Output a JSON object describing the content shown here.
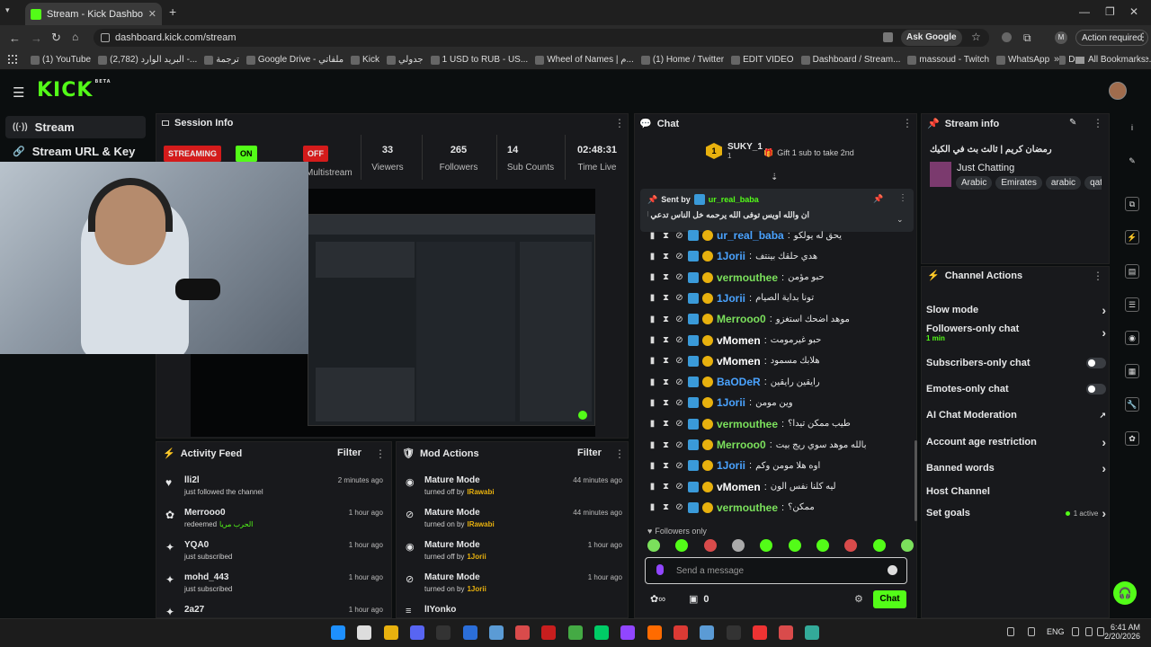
{
  "browser": {
    "tab_title": "Stream - Kick Dashboard",
    "url": "dashboard.kick.com/stream",
    "ask_google": "Ask Google",
    "action_required": "Action required",
    "profile_initial": "M"
  },
  "bookmarks": [
    "(1) YouTube",
    "(2,782) البريد الوارد -...",
    "ترجمة",
    "Google Drive - ملفاتي",
    "Kick",
    "جدولي",
    "1 USD to RUB - US...",
    "Wheel of Names | م...",
    "(1) Home / Twitter",
    "EDIT VIDEO",
    "Dashboard / Stream...",
    "massoud - Twitch",
    "WhatsApp",
    "Dashboard – Restre..."
  ],
  "all_bookmarks": "All Bookmarks",
  "logo": {
    "text": "KICK",
    "beta": "BETA"
  },
  "sidebar": {
    "items": [
      {
        "label": "Stream"
      },
      {
        "label": "Stream URL & Key"
      }
    ]
  },
  "session": {
    "title": "Session Info",
    "streaming": "STREAMING",
    "on": "ON",
    "off": "OFF",
    "multistream": "Multistream",
    "stats": [
      {
        "value": "33",
        "label": "Viewers"
      },
      {
        "value": "265",
        "label": "Followers"
      },
      {
        "value": "14",
        "label": "Sub Counts"
      },
      {
        "value": "02:48:31",
        "label": "Time Live"
      }
    ]
  },
  "activity": {
    "title": "Activity Feed",
    "filter": "Filter",
    "rows": [
      {
        "user": "lli2l",
        "text": "just followed the channel",
        "time": "2 minutes ago"
      },
      {
        "user": "Merrooo0",
        "text": "redeemed",
        "extra": "الحرب مريا",
        "time": "1 hour ago"
      },
      {
        "user": "YQA0",
        "text": "just subscribed",
        "time": "1 hour ago"
      },
      {
        "user": "mohd_443",
        "text": "just subscribed",
        "time": "1 hour ago"
      },
      {
        "user": "2a27",
        "text": "",
        "time": "1 hour ago"
      }
    ]
  },
  "modactions": {
    "title": "Mod Actions",
    "filter": "Filter",
    "rows": [
      {
        "title": "Mature Mode",
        "text": "turned off by",
        "by": "lRawabi",
        "time": "44 minutes ago"
      },
      {
        "title": "Mature Mode",
        "text": "turned on by",
        "by": "lRawabi",
        "time": "44 minutes ago"
      },
      {
        "title": "Mature Mode",
        "text": "turned off by",
        "by": "1Jorii",
        "time": "1 hour ago"
      },
      {
        "title": "Mature Mode",
        "text": "turned on by",
        "by": "1Jorii",
        "time": "1 hour ago"
      },
      {
        "title": "lIYonko",
        "text": "",
        "by": "",
        "time": ""
      }
    ]
  },
  "chat": {
    "title": "Chat",
    "gifter": "SUKY_1",
    "gifter_count": "1",
    "gift_prompt": "Gift 1 sub to take 2nd",
    "pinned_label": "Sent by",
    "pinned_user": "ur_real_baba",
    "pinned_text": "ان والله اويس توفى الله يرحمه خل الناس تدعي له بالرحمة",
    "messages": [
      {
        "user": "ur_real_baba",
        "text": "يحق له يولكو",
        "color": "#4aa3ff"
      },
      {
        "user": "1Jorii",
        "text": "هدي حلقك بينتف",
        "color": "#4aa3ff"
      },
      {
        "user": "vermouthee",
        "text": "حبو مؤمن",
        "color": "#7be05c"
      },
      {
        "user": "1Jorii",
        "text": "تونا بداية الصيام",
        "color": "#4aa3ff"
      },
      {
        "user": "Merrooo0",
        "text": "موهد اضحك استغزو",
        "color": "#7be05c"
      },
      {
        "user": "vMomen",
        "text": "حبو غيرمومت",
        "color": "#ffffff"
      },
      {
        "user": "vMomen",
        "text": "هلابك مسمود",
        "color": "#ffffff"
      },
      {
        "user": "BaODeR",
        "text": "رايقين رايقين",
        "color": "#4aa3ff"
      },
      {
        "user": "1Jorii",
        "text": "وين مومن",
        "color": "#4aa3ff"
      },
      {
        "user": "vermouthee",
        "text": "طيب ممكن تيدا؟",
        "color": "#7be05c"
      },
      {
        "user": "Merrooo0",
        "text": "بالله موهد سوي ريج بيت",
        "color": "#7be05c"
      },
      {
        "user": "1Jorii",
        "text": "اوه هلا مومن وكم",
        "color": "#4aa3ff"
      },
      {
        "user": "vMomen",
        "text": "ليه كلنا نفس الون",
        "color": "#ffffff"
      },
      {
        "user": "vermouthee",
        "text": "ممكن؟",
        "color": "#7be05c"
      }
    ],
    "followers_only": "Followers only",
    "placeholder": "Send a message",
    "points": "0",
    "send": "Chat"
  },
  "streaminfo": {
    "title": "Stream info",
    "stream_title": "رمضان كريم | ثالث بث في الكيك",
    "category": "Just Chatting",
    "tags": [
      "Arabic",
      "Emirates",
      "arabic",
      "qat"
    ]
  },
  "channel": {
    "title": "Channel Actions",
    "items": [
      {
        "label": "Slow mode"
      },
      {
        "label": "Followers-only chat",
        "sub": "1 min"
      },
      {
        "label": "Subscribers-only chat"
      },
      {
        "label": "Emotes-only chat"
      },
      {
        "label": "AI Chat Moderation"
      },
      {
        "label": "Account age restriction"
      },
      {
        "label": "Banned words"
      },
      {
        "label": "Host Channel"
      },
      {
        "label": "Set goals",
        "sub": "1 active"
      }
    ]
  },
  "taskbar": {
    "lang": "ENG",
    "time": "6:41 AM",
    "date": "2/20/2026"
  },
  "colors": {
    "accent": "#53fc18",
    "bg": "#0b0e0f",
    "panel": "#18191c"
  }
}
